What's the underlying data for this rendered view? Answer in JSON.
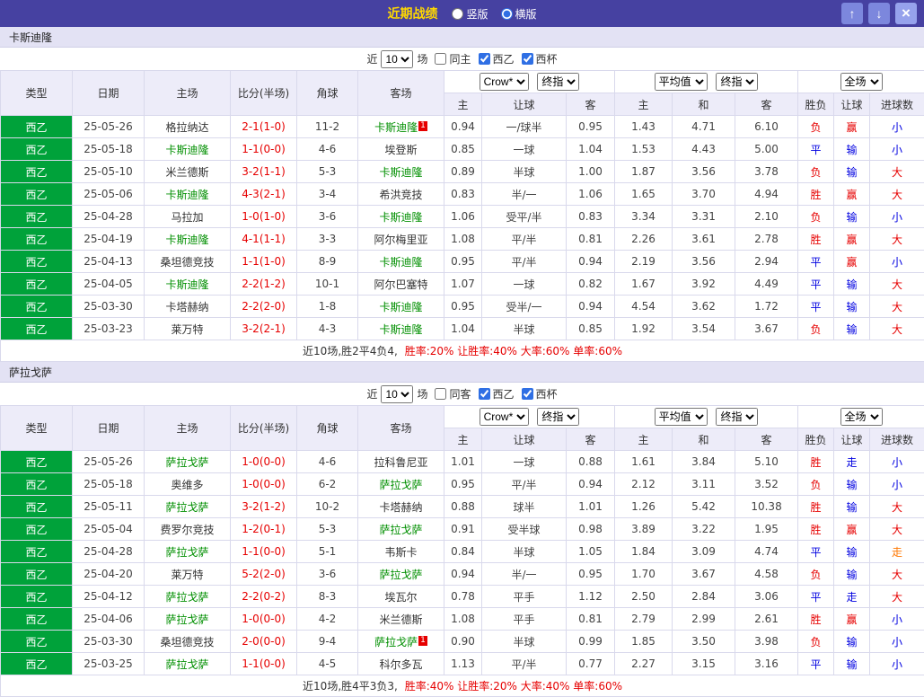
{
  "topbar": {
    "title": "近期战绩",
    "layout_options": [
      {
        "label": "竖版",
        "selected": false
      },
      {
        "label": "横版",
        "selected": true
      }
    ],
    "up_icon": "↑",
    "down_icon": "↓",
    "close_icon": "×"
  },
  "colors": {
    "topbar_bg": "#4641a1",
    "title_yellow": "#ffd800",
    "header_bg": "#edecf9",
    "team_header_bg": "#e3e2f4",
    "type_green": "#00a23a",
    "focus_team_green": "#008f00",
    "red": "#e60000",
    "blue": "#0000e0",
    "orange": "#ff7700"
  },
  "filter": {
    "prefix": "近",
    "count": "10",
    "suffix": "场"
  },
  "table_header": {
    "cols": [
      "类型",
      "日期",
      "主场",
      "比分(半场)",
      "角球",
      "客场"
    ],
    "odds_select": "Crow*",
    "odds_time_select": "终指",
    "avg_select": "平均值",
    "avg_time_select": "终指",
    "fulltime_select": "全场",
    "sub1": [
      "主",
      "让球",
      "客"
    ],
    "sub2": [
      "主",
      "和",
      "客"
    ],
    "sub3": [
      "胜负",
      "让球",
      "进球数"
    ]
  },
  "sections": [
    {
      "team": "卡斯迪隆",
      "filters": [
        {
          "label": "同主",
          "checked": false
        },
        {
          "label": "西乙",
          "checked": true
        },
        {
          "label": "西杯",
          "checked": true
        }
      ],
      "summary_prefix": "近10场,胜2平4负4,",
      "summary_stats": "胜率:20% 让胜率:40% 大率:60% 单率:60%",
      "rows": [
        {
          "type": "西乙",
          "date": "25-05-26",
          "home": "格拉纳达",
          "home_focus": false,
          "score": "2-1(1-0)",
          "corner": "11-2",
          "away": "卡斯迪隆",
          "away_focus": true,
          "away_badge": "1",
          "odds": [
            "0.94",
            "一/球半",
            "0.95"
          ],
          "avg": [
            "1.43",
            "4.71",
            "6.10"
          ],
          "result": {
            "t": "负",
            "c": "r"
          },
          "handicap": {
            "t": "赢",
            "c": "r"
          },
          "goals": {
            "t": "小",
            "c": "b"
          }
        },
        {
          "type": "西乙",
          "date": "25-05-18",
          "home": "卡斯迪隆",
          "home_focus": true,
          "score": "1-1(0-0)",
          "corner": "4-6",
          "away": "埃登斯",
          "away_focus": false,
          "odds": [
            "0.85",
            "一球",
            "1.04"
          ],
          "avg": [
            "1.53",
            "4.43",
            "5.00"
          ],
          "result": {
            "t": "平",
            "c": "b"
          },
          "handicap": {
            "t": "输",
            "c": "b"
          },
          "goals": {
            "t": "小",
            "c": "b"
          }
        },
        {
          "type": "西乙",
          "date": "25-05-10",
          "home": "米兰德斯",
          "home_focus": false,
          "score": "3-2(1-1)",
          "corner": "5-3",
          "away": "卡斯迪隆",
          "away_focus": true,
          "odds": [
            "0.89",
            "半球",
            "1.00"
          ],
          "avg": [
            "1.87",
            "3.56",
            "3.78"
          ],
          "result": {
            "t": "负",
            "c": "r"
          },
          "handicap": {
            "t": "输",
            "c": "b"
          },
          "goals": {
            "t": "大",
            "c": "r"
          }
        },
        {
          "type": "西乙",
          "date": "25-05-06",
          "home": "卡斯迪隆",
          "home_focus": true,
          "score": "4-3(2-1)",
          "corner": "3-4",
          "away": "希洪竞技",
          "away_focus": false,
          "odds": [
            "0.83",
            "半/一",
            "1.06"
          ],
          "avg": [
            "1.65",
            "3.70",
            "4.94"
          ],
          "result": {
            "t": "胜",
            "c": "r"
          },
          "handicap": {
            "t": "赢",
            "c": "r"
          },
          "goals": {
            "t": "大",
            "c": "r"
          }
        },
        {
          "type": "西乙",
          "date": "25-04-28",
          "home": "马拉加",
          "home_focus": false,
          "score": "1-0(1-0)",
          "corner": "3-6",
          "away": "卡斯迪隆",
          "away_focus": true,
          "odds": [
            "1.06",
            "受平/半",
            "0.83"
          ],
          "avg": [
            "3.34",
            "3.31",
            "2.10"
          ],
          "result": {
            "t": "负",
            "c": "r"
          },
          "handicap": {
            "t": "输",
            "c": "b"
          },
          "goals": {
            "t": "小",
            "c": "b"
          }
        },
        {
          "type": "西乙",
          "date": "25-04-19",
          "home": "卡斯迪隆",
          "home_focus": true,
          "score": "4-1(1-1)",
          "corner": "3-3",
          "away": "阿尔梅里亚",
          "away_focus": false,
          "odds": [
            "1.08",
            "平/半",
            "0.81"
          ],
          "avg": [
            "2.26",
            "3.61",
            "2.78"
          ],
          "result": {
            "t": "胜",
            "c": "r"
          },
          "handicap": {
            "t": "赢",
            "c": "r"
          },
          "goals": {
            "t": "大",
            "c": "r"
          }
        },
        {
          "type": "西乙",
          "date": "25-04-13",
          "home": "桑坦德竞技",
          "home_focus": false,
          "score": "1-1(1-0)",
          "corner": "8-9",
          "away": "卡斯迪隆",
          "away_focus": true,
          "odds": [
            "0.95",
            "平/半",
            "0.94"
          ],
          "avg": [
            "2.19",
            "3.56",
            "2.94"
          ],
          "result": {
            "t": "平",
            "c": "b"
          },
          "handicap": {
            "t": "赢",
            "c": "r"
          },
          "goals": {
            "t": "小",
            "c": "b"
          }
        },
        {
          "type": "西乙",
          "date": "25-04-05",
          "home": "卡斯迪隆",
          "home_focus": true,
          "score": "2-2(1-2)",
          "corner": "10-1",
          "away": "阿尔巴塞特",
          "away_focus": false,
          "odds": [
            "1.07",
            "一球",
            "0.82"
          ],
          "avg": [
            "1.67",
            "3.92",
            "4.49"
          ],
          "result": {
            "t": "平",
            "c": "b"
          },
          "handicap": {
            "t": "输",
            "c": "b"
          },
          "goals": {
            "t": "大",
            "c": "r"
          }
        },
        {
          "type": "西乙",
          "date": "25-03-30",
          "home": "卡塔赫纳",
          "home_focus": false,
          "score": "2-2(2-0)",
          "corner": "1-8",
          "away": "卡斯迪隆",
          "away_focus": true,
          "odds": [
            "0.95",
            "受半/一",
            "0.94"
          ],
          "avg": [
            "4.54",
            "3.62",
            "1.72"
          ],
          "result": {
            "t": "平",
            "c": "b"
          },
          "handicap": {
            "t": "输",
            "c": "b"
          },
          "goals": {
            "t": "大",
            "c": "r"
          }
        },
        {
          "type": "西乙",
          "date": "25-03-23",
          "home": "莱万特",
          "home_focus": false,
          "score": "3-2(2-1)",
          "corner": "4-3",
          "away": "卡斯迪隆",
          "away_focus": true,
          "odds": [
            "1.04",
            "半球",
            "0.85"
          ],
          "avg": [
            "1.92",
            "3.54",
            "3.67"
          ],
          "result": {
            "t": "负",
            "c": "r"
          },
          "handicap": {
            "t": "输",
            "c": "b"
          },
          "goals": {
            "t": "大",
            "c": "r"
          }
        }
      ]
    },
    {
      "team": "萨拉戈萨",
      "filters": [
        {
          "label": "同客",
          "checked": false
        },
        {
          "label": "西乙",
          "checked": true
        },
        {
          "label": "西杯",
          "checked": true
        }
      ],
      "summary_prefix": "近10场,胜4平3负3,",
      "summary_stats": "胜率:40% 让胜率:20% 大率:40% 单率:60%",
      "rows": [
        {
          "type": "西乙",
          "date": "25-05-26",
          "home": "萨拉戈萨",
          "home_focus": true,
          "score": "1-0(0-0)",
          "corner": "4-6",
          "away": "拉科鲁尼亚",
          "away_focus": false,
          "odds": [
            "1.01",
            "一球",
            "0.88"
          ],
          "avg": [
            "1.61",
            "3.84",
            "5.10"
          ],
          "result": {
            "t": "胜",
            "c": "r"
          },
          "handicap": {
            "t": "走",
            "c": "b"
          },
          "goals": {
            "t": "小",
            "c": "b"
          }
        },
        {
          "type": "西乙",
          "date": "25-05-18",
          "home": "奥维多",
          "home_focus": false,
          "score": "1-0(0-0)",
          "corner": "6-2",
          "away": "萨拉戈萨",
          "away_focus": true,
          "odds": [
            "0.95",
            "平/半",
            "0.94"
          ],
          "avg": [
            "2.12",
            "3.11",
            "3.52"
          ],
          "result": {
            "t": "负",
            "c": "r"
          },
          "handicap": {
            "t": "输",
            "c": "b"
          },
          "goals": {
            "t": "小",
            "c": "b"
          }
        },
        {
          "type": "西乙",
          "date": "25-05-11",
          "home": "萨拉戈萨",
          "home_focus": true,
          "score": "3-2(1-2)",
          "corner": "10-2",
          "away": "卡塔赫纳",
          "away_focus": false,
          "odds": [
            "0.88",
            "球半",
            "1.01"
          ],
          "avg": [
            "1.26",
            "5.42",
            "10.38"
          ],
          "result": {
            "t": "胜",
            "c": "r"
          },
          "handicap": {
            "t": "输",
            "c": "b"
          },
          "goals": {
            "t": "大",
            "c": "r"
          }
        },
        {
          "type": "西乙",
          "date": "25-05-04",
          "home": "费罗尔竞技",
          "home_focus": false,
          "score": "1-2(0-1)",
          "corner": "5-3",
          "away": "萨拉戈萨",
          "away_focus": true,
          "odds": [
            "0.91",
            "受半球",
            "0.98"
          ],
          "avg": [
            "3.89",
            "3.22",
            "1.95"
          ],
          "result": {
            "t": "胜",
            "c": "r"
          },
          "handicap": {
            "t": "赢",
            "c": "r"
          },
          "goals": {
            "t": "大",
            "c": "r"
          }
        },
        {
          "type": "西乙",
          "date": "25-04-28",
          "home": "萨拉戈萨",
          "home_focus": true,
          "score": "1-1(0-0)",
          "corner": "5-1",
          "away": "韦斯卡",
          "away_focus": false,
          "odds": [
            "0.84",
            "半球",
            "1.05"
          ],
          "avg": [
            "1.84",
            "3.09",
            "4.74"
          ],
          "result": {
            "t": "平",
            "c": "b"
          },
          "handicap": {
            "t": "输",
            "c": "b"
          },
          "goals": {
            "t": "走",
            "c": "o"
          }
        },
        {
          "type": "西乙",
          "date": "25-04-20",
          "home": "莱万特",
          "home_focus": false,
          "score": "5-2(2-0)",
          "corner": "3-6",
          "away": "萨拉戈萨",
          "away_focus": true,
          "odds": [
            "0.94",
            "半/一",
            "0.95"
          ],
          "avg": [
            "1.70",
            "3.67",
            "4.58"
          ],
          "result": {
            "t": "负",
            "c": "r"
          },
          "handicap": {
            "t": "输",
            "c": "b"
          },
          "goals": {
            "t": "大",
            "c": "r"
          }
        },
        {
          "type": "西乙",
          "date": "25-04-12",
          "home": "萨拉戈萨",
          "home_focus": true,
          "score": "2-2(0-2)",
          "corner": "8-3",
          "away": "埃瓦尔",
          "away_focus": false,
          "odds": [
            "0.78",
            "平手",
            "1.12"
          ],
          "avg": [
            "2.50",
            "2.84",
            "3.06"
          ],
          "result": {
            "t": "平",
            "c": "b"
          },
          "handicap": {
            "t": "走",
            "c": "b"
          },
          "goals": {
            "t": "大",
            "c": "r"
          }
        },
        {
          "type": "西乙",
          "date": "25-04-06",
          "home": "萨拉戈萨",
          "home_focus": true,
          "score": "1-0(0-0)",
          "corner": "4-2",
          "away": "米兰德斯",
          "away_focus": false,
          "odds": [
            "1.08",
            "平手",
            "0.81"
          ],
          "avg": [
            "2.79",
            "2.99",
            "2.61"
          ],
          "result": {
            "t": "胜",
            "c": "r"
          },
          "handicap": {
            "t": "赢",
            "c": "r"
          },
          "goals": {
            "t": "小",
            "c": "b"
          }
        },
        {
          "type": "西乙",
          "date": "25-03-30",
          "home": "桑坦德竞技",
          "home_focus": false,
          "score": "2-0(0-0)",
          "corner": "9-4",
          "away": "萨拉戈萨",
          "away_focus": true,
          "away_badge": "1",
          "odds": [
            "0.90",
            "半球",
            "0.99"
          ],
          "avg": [
            "1.85",
            "3.50",
            "3.98"
          ],
          "result": {
            "t": "负",
            "c": "r"
          },
          "handicap": {
            "t": "输",
            "c": "b"
          },
          "goals": {
            "t": "小",
            "c": "b"
          }
        },
        {
          "type": "西乙",
          "date": "25-03-25",
          "home": "萨拉戈萨",
          "home_focus": true,
          "score": "1-1(0-0)",
          "corner": "4-5",
          "away": "科尔多瓦",
          "away_focus": false,
          "odds": [
            "1.13",
            "平/半",
            "0.77"
          ],
          "avg": [
            "2.27",
            "3.15",
            "3.16"
          ],
          "result": {
            "t": "平",
            "c": "b"
          },
          "handicap": {
            "t": "输",
            "c": "b"
          },
          "goals": {
            "t": "小",
            "c": "b"
          }
        }
      ]
    }
  ]
}
